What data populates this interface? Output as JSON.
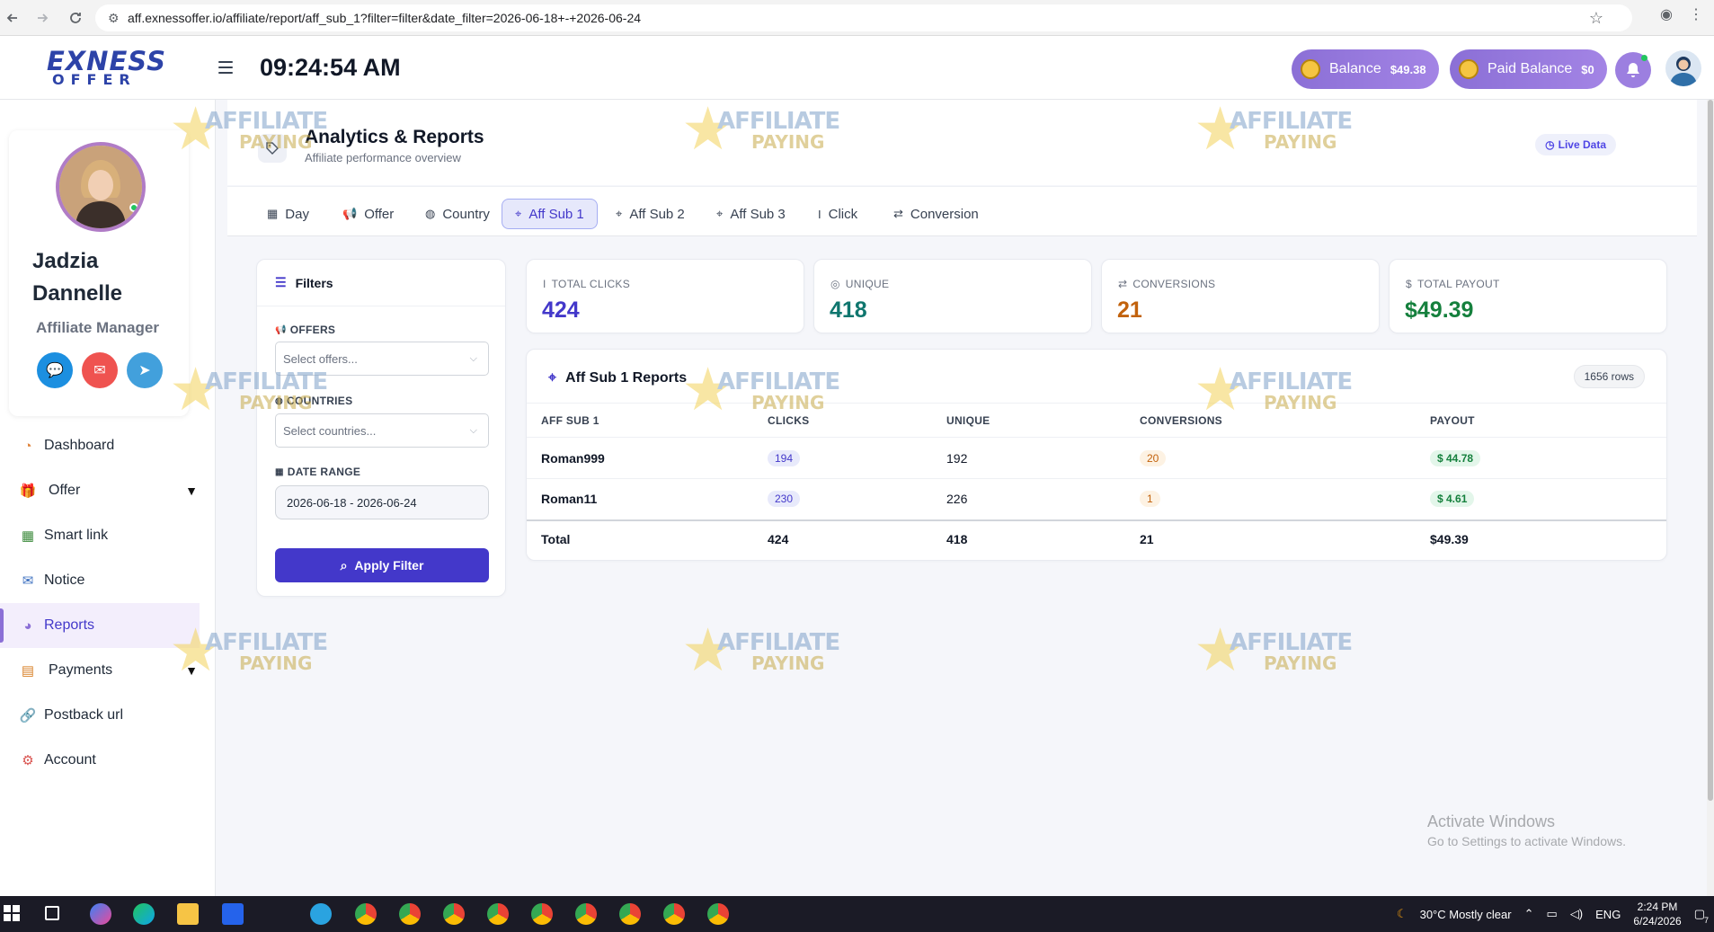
{
  "browser": {
    "url": "aff.exnessoffer.io/affiliate/report/aff_sub_1?filter=filter&date_filter=2026-06-18+-+2026-06-24"
  },
  "header": {
    "logo_line1": "EXNESS",
    "logo_line2": "OFFER",
    "clock": "09:24:54 AM",
    "balance_label": "Balance",
    "balance_value": "$49.38",
    "paid_balance_label": "Paid Balance",
    "paid_balance_value": "$0"
  },
  "profile": {
    "first_name": "Jadzia",
    "last_name": "Dannelle",
    "role": "Affiliate Manager"
  },
  "sidebar": {
    "items": [
      {
        "label": "Dashboard",
        "icon": "dashboard-icon"
      },
      {
        "label": "Offer",
        "icon": "gift-icon"
      },
      {
        "label": "Smart link",
        "icon": "grid-icon"
      },
      {
        "label": "Notice",
        "icon": "mail-icon"
      },
      {
        "label": "Reports",
        "icon": "reports-icon"
      },
      {
        "label": "Payments",
        "icon": "wallet-icon"
      },
      {
        "label": "Postback url",
        "icon": "link-icon"
      },
      {
        "label": "Account",
        "icon": "account-icon"
      }
    ],
    "active": "Reports"
  },
  "page": {
    "title": "Analytics & Reports",
    "subtitle": "Affiliate performance overview",
    "live_label": "Live Data"
  },
  "tabs": [
    {
      "label": "Day",
      "icon": "calendar-icon"
    },
    {
      "label": "Offer",
      "icon": "megaphone-icon"
    },
    {
      "label": "Country",
      "icon": "globe-icon"
    },
    {
      "label": "Aff Sub 1",
      "icon": "tag-icon"
    },
    {
      "label": "Aff Sub 2",
      "icon": "tag-icon"
    },
    {
      "label": "Aff Sub 3",
      "icon": "tag-icon"
    },
    {
      "label": "Click",
      "icon": "cursor-icon"
    },
    {
      "label": "Conversion",
      "icon": "exchange-icon"
    }
  ],
  "active_tab": "Aff Sub 1",
  "filters": {
    "title": "Filters",
    "offers_label": "OFFERS",
    "offers_placeholder": "Select offers...",
    "countries_label": "COUNTRIES",
    "countries_placeholder": "Select countries...",
    "date_label": "DATE RANGE",
    "date_value": "2026-06-18 - 2026-06-24",
    "apply_label": "Apply Filter"
  },
  "stats": [
    {
      "label": "TOTAL CLICKS",
      "value": "424",
      "color": "#4338ca"
    },
    {
      "label": "UNIQUE",
      "value": "418",
      "color": "#0f766e"
    },
    {
      "label": "CONVERSIONS",
      "value": "21",
      "color": "#c2620c"
    },
    {
      "label": "TOTAL PAYOUT",
      "value": "$49.39",
      "color": "#15803d"
    }
  ],
  "report": {
    "title": "Aff Sub 1 Reports",
    "rows_badge": "1656 rows",
    "columns": [
      "AFF SUB 1",
      "CLICKS",
      "UNIQUE",
      "CONVERSIONS",
      "PAYOUT"
    ],
    "rows": [
      {
        "sub": "Roman999",
        "clicks": "194",
        "unique": "192",
        "conversions": "20",
        "payout": "$ 44.78"
      },
      {
        "sub": "Roman11",
        "clicks": "230",
        "unique": "226",
        "conversions": "1",
        "payout": "$ 4.61"
      }
    ],
    "total": {
      "label": "Total",
      "clicks": "424",
      "unique": "418",
      "conversions": "21",
      "payout": "$49.39"
    }
  },
  "watermark": {
    "line1": "AFFILIATE",
    "line2": "PAYING"
  },
  "windows_notice": {
    "line1": "Activate Windows",
    "line2": "Go to Settings to activate Windows."
  },
  "taskbar": {
    "weather": "30°C  Mostly clear",
    "lang": "ENG",
    "time": "2:24 PM",
    "date": "6/24/2026",
    "notif_count": "7"
  }
}
